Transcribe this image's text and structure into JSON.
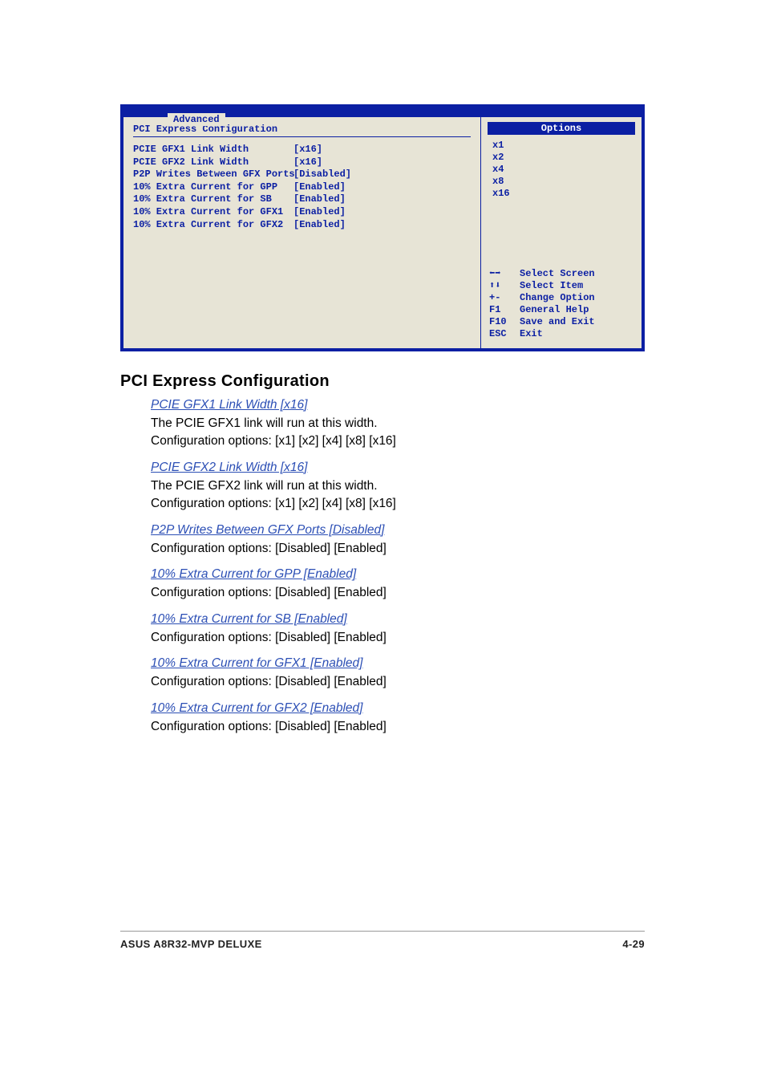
{
  "bios": {
    "tab_label": "Advanced",
    "title": "PCI Express Configuration",
    "rows": [
      {
        "label": "PCIE GFX1 Link Width",
        "value": "[x16]"
      },
      {
        "label": "PCIE GFX2 Link Width",
        "value": "[x16]"
      },
      {
        "label": "P2P Writes Between GFX Ports",
        "value": "[Disabled]"
      },
      {
        "label": "10% Extra Current for GPP",
        "value": "[Enabled]"
      },
      {
        "label": "10% Extra Current for SB",
        "value": "[Enabled]"
      },
      {
        "label": "10% Extra Current for GFX1",
        "value": "[Enabled]"
      },
      {
        "label": "10% Extra Current for GFX2",
        "value": "[Enabled]"
      }
    ],
    "options_title": "Options",
    "options": [
      "x1",
      "x2",
      "x4",
      "x8",
      "x16"
    ],
    "keyhelp": [
      {
        "key": "⬅➡",
        "text": "Select Screen"
      },
      {
        "key": "⬆⬇",
        "text": "Select Item"
      },
      {
        "key": "+-",
        "text": "Change Option"
      },
      {
        "key": "F1",
        "text": "General Help"
      },
      {
        "key": "F10",
        "text": "Save and Exit"
      },
      {
        "key": "ESC",
        "text": "Exit"
      }
    ]
  },
  "section_heading": "PCI Express Configuration",
  "items": [
    {
      "title": "PCIE GFX1 Link Width [x16]",
      "desc1": "The PCIE GFX1 link will run at this width.",
      "desc2": "Configuration options: [x1] [x2] [x4] [x8] [x16]"
    },
    {
      "title": "PCIE GFX2 Link Width [x16]",
      "desc1": "The PCIE GFX2 link will run at this width.",
      "desc2": "Configuration options: [x1] [x2] [x4] [x8] [x16]"
    },
    {
      "title": "P2P Writes Between GFX Ports [Disabled]",
      "desc1": "Configuration options: [Disabled] [Enabled]",
      "desc2": ""
    },
    {
      "title": "10% Extra Current for GPP [Enabled]",
      "desc1": "Configuration options: [Disabled] [Enabled]",
      "desc2": ""
    },
    {
      "title": "10% Extra Current for SB [Enabled]",
      "desc1": "Configuration options: [Disabled] [Enabled]",
      "desc2": ""
    },
    {
      "title": "10% Extra Current for GFX1 [Enabled]",
      "desc1": "Configuration options: [Disabled] [Enabled]",
      "desc2": ""
    },
    {
      "title": "10% Extra Current for GFX2 [Enabled]",
      "desc1": "Configuration options: [Disabled] [Enabled]",
      "desc2": ""
    }
  ],
  "footer": {
    "left": "ASUS A8R32-MVP DELUXE",
    "right": "4-29"
  }
}
